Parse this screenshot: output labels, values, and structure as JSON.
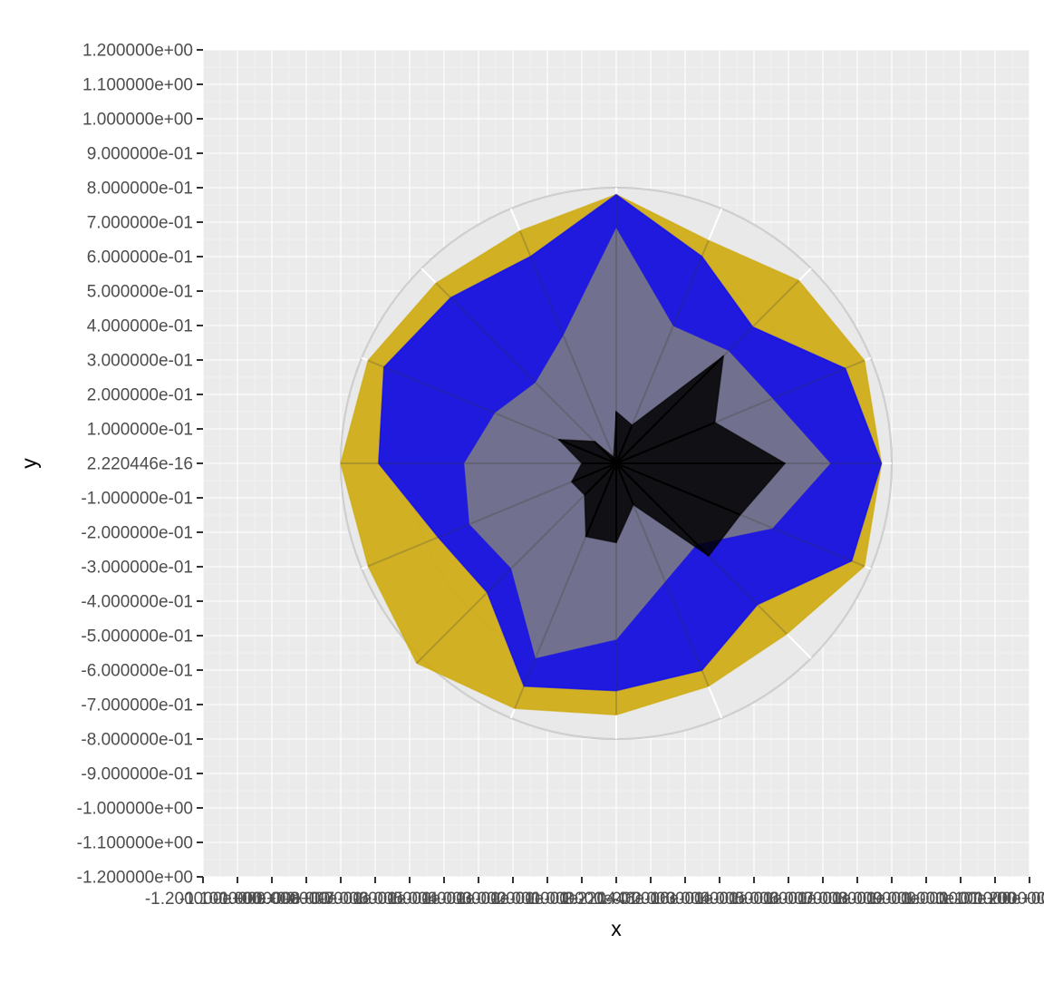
{
  "chart_data": {
    "type": "area",
    "subtype": "radar",
    "title": "",
    "xlabel": "x",
    "ylabel": "y",
    "xlim": [
      -1.2,
      1.2
    ],
    "ylim": [
      -1.2,
      1.2
    ],
    "grid": true,
    "legend": "none",
    "y_ticks": [
      "1.200000e+00",
      "1.100000e+00",
      "1.000000e+00",
      "9.000000e-01",
      "8.000000e-01",
      "7.000000e-01",
      "6.000000e-01",
      "5.000000e-01",
      "4.000000e-01",
      "3.000000e-01",
      "2.000000e-01",
      "1.000000e-01",
      "2.220446e-16",
      "-1.000000e-01",
      "-2.000000e-01",
      "-3.000000e-01",
      "-4.000000e-01",
      "-5.000000e-01",
      "-6.000000e-01",
      "-7.000000e-01",
      "-8.000000e-01",
      "-9.000000e-01",
      "-1.000000e+00",
      "-1.100000e+00",
      "-1.200000e+00"
    ],
    "y_tick_values": [
      1.2,
      1.1,
      1.0,
      0.9,
      0.8,
      0.7,
      0.6,
      0.5,
      0.4,
      0.3,
      0.2,
      0.1,
      0,
      -0.1,
      -0.2,
      -0.3,
      -0.4,
      -0.5,
      -0.6,
      -0.7,
      -0.8,
      -0.9,
      -1.0,
      -1.1,
      -1.2
    ],
    "x_tick_values": [
      -1.2,
      -1.1,
      -1.0,
      -0.9,
      -0.8,
      -0.7,
      -0.6,
      -0.5,
      -0.4,
      -0.3,
      -0.2,
      -0.1,
      0,
      0.1,
      0.2,
      0.3,
      0.4,
      0.5,
      0.6,
      0.7,
      0.8,
      0.9,
      1.0,
      1.1,
      1.2
    ],
    "x_ticks": [
      "-1.200000e+00",
      "-1.100000e+00",
      "-1.000000e+00",
      "-9.000000e-01",
      "-8.000000e-01",
      "-7.000000e-01",
      "-6.000000e-01",
      "-5.000000e-01",
      "-4.000000e-01",
      "-3.000000e-01",
      "-2.000000e-01",
      "-1.000000e-01",
      "2.220446e-16",
      "1.000000e-01",
      "2.000000e-01",
      "3.000000e-01",
      "4.000000e-01",
      "5.000000e-01",
      "6.000000e-01",
      "7.000000e-01",
      "8.000000e-01",
      "9.000000e-01",
      "1.000000e+00",
      "1.100000e+00",
      "1.200000e+00"
    ],
    "radial_levels": [
      0.2,
      0.4,
      0.6,
      0.8
    ],
    "angles_deg": [
      90,
      67.5,
      45,
      22.5,
      0,
      -22.5,
      -45,
      -67.5,
      -90,
      -112.5,
      -135,
      -157.5,
      180,
      157.5,
      135,
      112.5
    ],
    "series": [
      {
        "color": "#cca600",
        "values": [
          0.78,
          0.7,
          0.75,
          0.78,
          0.77,
          0.78,
          0.7,
          0.7,
          0.73,
          0.77,
          0.82,
          0.78,
          0.8,
          0.78,
          0.74,
          0.73
        ]
      },
      {
        "color": "#0000ff",
        "values": [
          0.78,
          0.65,
          0.56,
          0.72,
          0.77,
          0.74,
          0.58,
          0.65,
          0.66,
          0.7,
          0.53,
          0.56,
          0.69,
          0.73,
          0.68,
          0.65
        ]
      },
      {
        "color": "#808080",
        "values": [
          0.68,
          0.43,
          0.46,
          0.49,
          0.62,
          0.49,
          0.33,
          0.37,
          0.51,
          0.61,
          0.43,
          0.46,
          0.44,
          0.38,
          0.33,
          0.4
        ]
      },
      {
        "color": "#000000",
        "values": [
          0.15,
          0.12,
          0.44,
          0.31,
          0.49,
          0.39,
          0.38,
          0.13,
          0.23,
          0.23,
          0.13,
          0.14,
          0.1,
          0.18,
          0.09,
          0.02
        ]
      }
    ]
  }
}
